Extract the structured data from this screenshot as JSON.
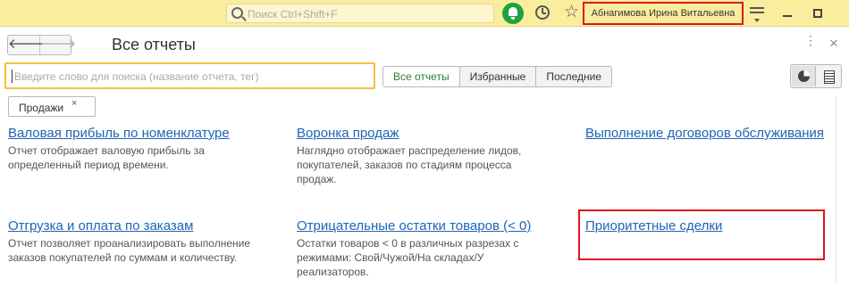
{
  "topbar": {
    "search_placeholder": "Поиск Ctrl+Shift+F",
    "user_name": "Абнагимова Ирина Витальевна"
  },
  "header": {
    "back_glyph": "🡐",
    "forward_glyph": "🡒",
    "title": "Все отчеты",
    "more_glyph": "⋮",
    "close_glyph": "×"
  },
  "search": {
    "placeholder": "Введите слово для поиска (название отчета, тег)"
  },
  "tabs": [
    "Все отчеты",
    "Избранные",
    "Последние"
  ],
  "filter": {
    "label": "Продажи",
    "remove_glyph": "×"
  },
  "reports": [
    {
      "title": "Валовая прибыль по номенклатуре",
      "desc_lines": [
        "Отчет отображает валовую прибыль за",
        "определенный период времени."
      ]
    },
    {
      "title": "Воронка продаж",
      "desc_lines": [
        "Наглядно отображает распределение лидов,",
        "покупателей, заказов по стадиям процесса",
        "продаж."
      ]
    },
    {
      "title": "Выполнение договоров обслуживания",
      "desc_lines": []
    },
    {
      "title": "Отгрузка и оплата по заказам",
      "desc_lines": [
        "Отчет позволяет проанализировать выполнение",
        "заказов покупателей по суммам и количеству."
      ]
    },
    {
      "title": "Отрицательные остатки товаров (< 0)",
      "desc_lines": [
        "Остатки товаров < 0 в различных разрезах с",
        "режимами: Свой/Чужой/На складах/У",
        "реализаторов."
      ]
    },
    {
      "title": "Приоритетные сделки",
      "desc_lines": []
    }
  ],
  "colors": {
    "topbar_bg": "#fbed9e",
    "link": "#2064b4",
    "accent_green": "#21a03f",
    "highlight_red": "#e0141e",
    "search_focus": "#f0c43c"
  }
}
